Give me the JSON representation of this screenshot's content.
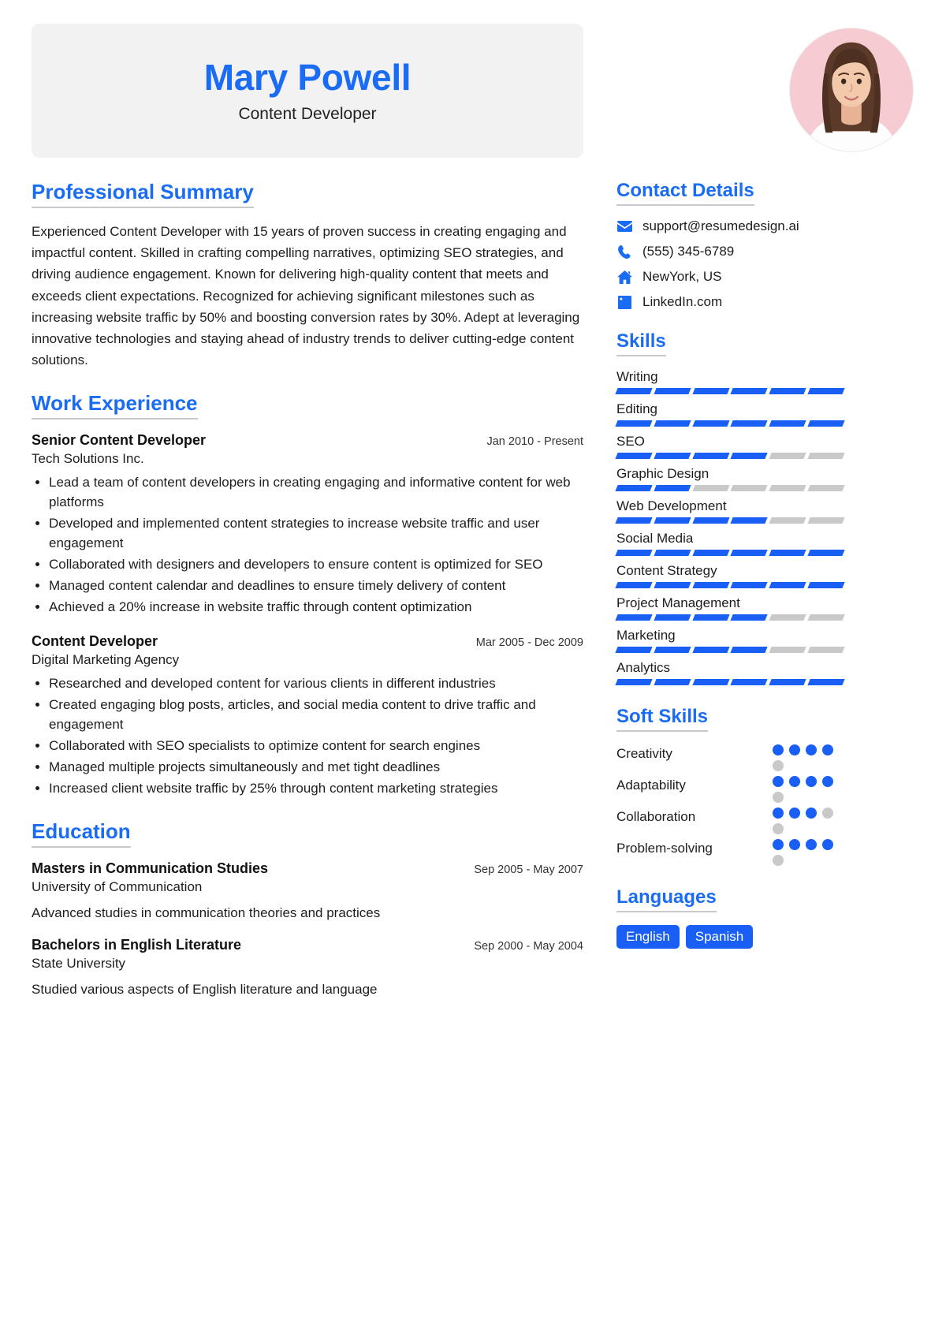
{
  "header": {
    "name": "Mary Powell",
    "job_title": "Content Developer",
    "accent_color": "#1a6cf5",
    "band_color": "#f2f2f2",
    "avatar_bg": "#f6ccd2"
  },
  "summary": {
    "heading": "Professional Summary",
    "text": "Experienced Content Developer with 15 years of proven success in creating engaging and impactful content. Skilled in crafting compelling narratives, optimizing SEO strategies, and driving audience engagement. Known for delivering high-quality content that meets and exceeds client expectations. Recognized for achieving significant milestones such as increasing website traffic by 50% and boosting conversion rates by 30%. Adept at leveraging innovative technologies and staying ahead of industry trends to deliver cutting-edge content solutions."
  },
  "experience": {
    "heading": "Work Experience",
    "entries": [
      {
        "role": "Senior Content Developer",
        "date": "Jan 2010 - Present",
        "org": "Tech Solutions Inc.",
        "bullets": [
          "Lead a team of content developers in creating engaging and informative content for web platforms",
          "Developed and implemented content strategies to increase website traffic and user engagement",
          "Collaborated with designers and developers to ensure content is optimized for SEO",
          "Managed content calendar and deadlines to ensure timely delivery of content",
          "Achieved a 20% increase in website traffic through content optimization"
        ]
      },
      {
        "role": "Content Developer",
        "date": "Mar 2005 - Dec 2009",
        "org": "Digital Marketing Agency",
        "bullets": [
          "Researched and developed content for various clients in different industries",
          "Created engaging blog posts, articles, and social media content to drive traffic and engagement",
          "Collaborated with SEO specialists to optimize content for search engines",
          "Managed multiple projects simultaneously and met tight deadlines",
          "Increased client website traffic by 25% through content marketing strategies"
        ]
      }
    ]
  },
  "education": {
    "heading": "Education",
    "entries": [
      {
        "degree": "Masters in Communication Studies",
        "date": "Sep 2005 - May 2007",
        "school": "University of Communication",
        "description": "Advanced studies in communication theories and practices"
      },
      {
        "degree": "Bachelors in English Literature",
        "date": "Sep 2000 - May 2004",
        "school": "State University",
        "description": "Studied various aspects of English literature and language"
      }
    ]
  },
  "contact": {
    "heading": "Contact Details",
    "items": [
      {
        "icon": "envelope-icon",
        "value": "support@resumedesign.ai"
      },
      {
        "icon": "phone-icon",
        "value": "(555) 345-6789"
      },
      {
        "icon": "home-icon",
        "value": "NewYork, US"
      },
      {
        "icon": "linkedin-icon",
        "value": "LinkedIn.com"
      }
    ]
  },
  "skills": {
    "heading": "Skills",
    "max_level": 6,
    "items": [
      {
        "name": "Writing",
        "level": 6
      },
      {
        "name": "Editing",
        "level": 6
      },
      {
        "name": "SEO",
        "level": 4
      },
      {
        "name": "Graphic Design",
        "level": 2
      },
      {
        "name": "Web Development",
        "level": 4
      },
      {
        "name": "Social Media",
        "level": 6
      },
      {
        "name": "Content Strategy",
        "level": 6
      },
      {
        "name": "Project Management",
        "level": 4
      },
      {
        "name": "Marketing",
        "level": 4
      },
      {
        "name": "Analytics",
        "level": 6
      }
    ]
  },
  "soft_skills": {
    "heading": "Soft Skills",
    "max_level": 5,
    "items": [
      {
        "name": "Creativity",
        "level": 4
      },
      {
        "name": "Adaptability",
        "level": 4
      },
      {
        "name": "Collaboration",
        "level": 3
      },
      {
        "name": "Problem-solving",
        "level": 4
      }
    ]
  },
  "languages": {
    "heading": "Languages",
    "items": [
      "English",
      "Spanish"
    ]
  }
}
